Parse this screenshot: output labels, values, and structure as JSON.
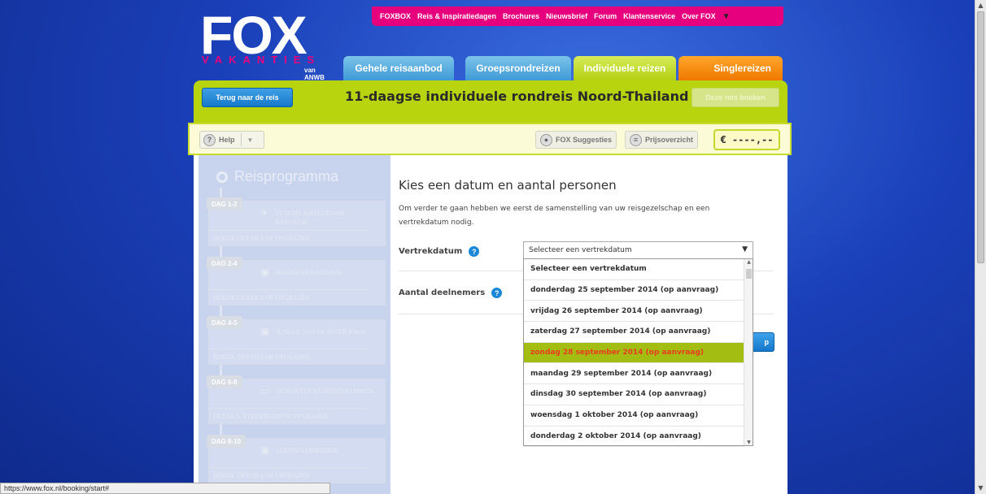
{
  "logo": {
    "brand": "FOX",
    "tagline": "VAKANTIES",
    "sub": "van ANWB"
  },
  "topnav": [
    "FOXBOX",
    "Reis & Inspiratiedagen",
    "Brochures",
    "Nieuwsbrief",
    "Forum",
    "Klantenservice",
    "Over FOX"
  ],
  "tabs": [
    {
      "label": "Gehele reisaanbod",
      "color": "#3e9ad6"
    },
    {
      "label": "Groepsrondreizen",
      "color": "#3e9ad6"
    },
    {
      "label": "Individuele reizen",
      "color": "#b4cf12"
    },
    {
      "label": "Singlereizen",
      "color": "#f07800"
    }
  ],
  "header": {
    "back_label": "Terug naar de reis",
    "title": "11-daagse individuele rondreis Noord-Thailand",
    "book_label": "Deze reis boeken"
  },
  "toolbar": {
    "help_label": "Help",
    "suggestions_label": "FOX Suggesties",
    "prices_label": "Prijsoverzicht",
    "price": "€ ----,--"
  },
  "itinerary": {
    "title": "Reisprogramma",
    "days": [
      {
        "badge": "DAG 1-2",
        "name": "VLUCHT AMSTERDAM - BANGKOK",
        "icon": "plane-icon",
        "upgrade": "BEKIJK DETAILS OF UPGRADES"
      },
      {
        "badge": "DAG 2-4",
        "name": "BRUISEND BANGKOK",
        "icon": "suitcase-icon",
        "upgrade": "BEKIJK DETAILS OF UPGRADES"
      },
      {
        "badge": "DAG 4-5",
        "name": "JUNGLE VAN DE RIVER KWAI",
        "icon": "suitcase-icon",
        "upgrade": "BEKIJK DETAILS OF UPGRADES"
      },
      {
        "badge": "DAG 6-8",
        "name": "OLIFANTEN EN BERGSTAMMEN",
        "icon": "bed-icon",
        "upgrade": "DETAILS, VERLENGEN OF UPGRADES"
      },
      {
        "badge": "DAG 8-10",
        "name": "GOUDEN DRIEHOEK",
        "icon": "suitcase-icon",
        "upgrade": "BEKIJK DETAILS OF UPGRADES"
      }
    ]
  },
  "form": {
    "heading": "Kies een datum en aantal personen",
    "intro": "Om verder te gaan hebben we eerst de samenstelling van uw reisgezelschap en een vertrekdatum nodig.",
    "departure_label": "Vertrekdatum",
    "participants_label": "Aantal deelnemers",
    "next_label": "p",
    "select_value": "Selecteer een vertrekdatum"
  },
  "dropdown_options": [
    "Selecteer een vertrekdatum",
    "donderdag 25 september 2014 (op aanvraag)",
    "vrijdag 26 september 2014 (op aanvraag)",
    "zaterdag 27 september 2014 (op aanvraag)",
    "zondag 28 september 2014 (op aanvraag)",
    "maandag 29 september 2014 (op aanvraag)",
    "dinsdag 30 september 2014 (op aanvraag)",
    "woensdag 1 oktober 2014 (op aanvraag)",
    "donderdag 2 oktober 2014 (op aanvraag)"
  ],
  "selected_option_index": 4,
  "status_bar": "https://www.fox.nl/booking/start#"
}
